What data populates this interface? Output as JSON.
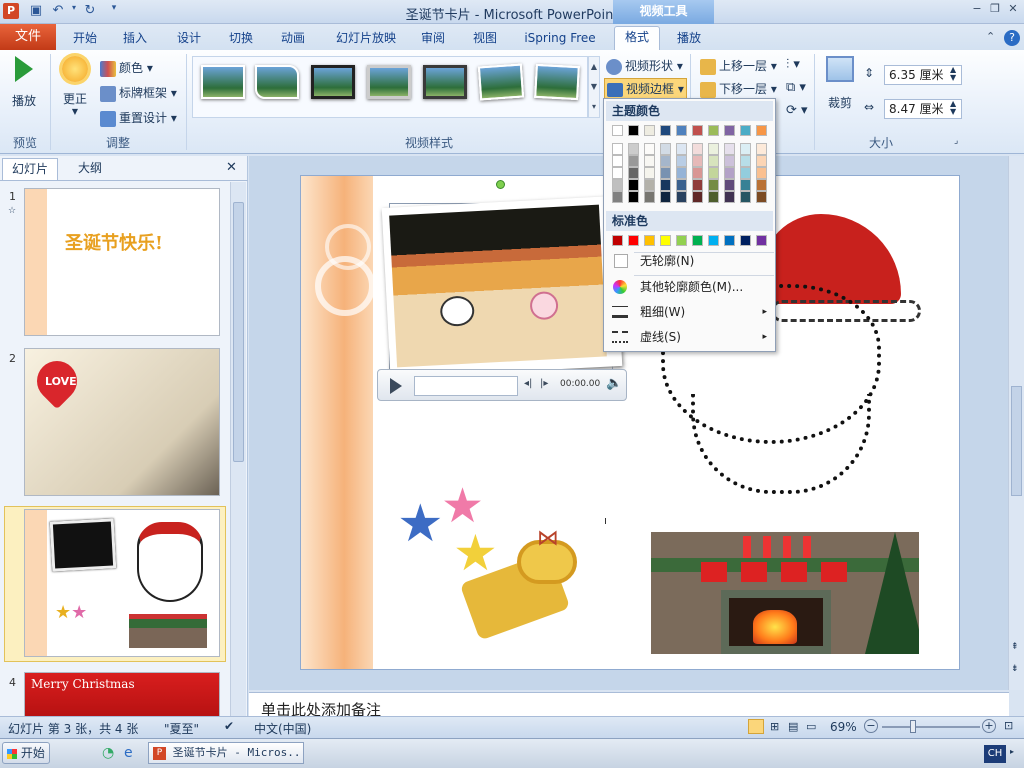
{
  "window": {
    "title": "圣诞节卡片 - Microsoft PowerPoint",
    "context_tab_group": "视频工具",
    "app_icon": "P",
    "controls": {
      "minimize": "−",
      "restore": "❐",
      "close": "✕"
    }
  },
  "tabs": {
    "file": "文件",
    "items": [
      "开始",
      "插入",
      "设计",
      "切换",
      "动画",
      "幻灯片放映",
      "审阅",
      "视图",
      "iSpring Free",
      "格式",
      "播放"
    ],
    "selected": "格式"
  },
  "ribbon": {
    "preview": {
      "play": "播放",
      "group": "预览"
    },
    "adjust": {
      "correct": "更正",
      "color": "颜色",
      "poster_frame": "标牌框架",
      "reset": "重置设计",
      "group": "调整"
    },
    "video_styles": {
      "group": "视频样式"
    },
    "video_shape": "视频形状",
    "video_border": "视频边框",
    "arrange": {
      "bring_forward": "上移一层",
      "send_backward": "下移一层"
    },
    "size": {
      "crop": "裁剪",
      "height": "6.35 厘米",
      "width": "8.47 厘米",
      "group": "大小"
    }
  },
  "panel": {
    "tab_slides": "幻灯片",
    "tab_outline": "大纲",
    "close": "✕",
    "slides": [
      {
        "num": "1",
        "title": "圣诞节快乐!"
      },
      {
        "num": "2",
        "title": "LOVE"
      },
      {
        "num": "3",
        "title": ""
      },
      {
        "num": "4",
        "title": "Merry Christmas"
      }
    ]
  },
  "border_menu": {
    "theme_colors_header": "主题颜色",
    "standard_colors_header": "标准色",
    "no_outline": "无轮廓(N)",
    "more_colors": "其他轮廓颜色(M)...",
    "weight": "粗细(W)",
    "dashes": "虚线(S)",
    "theme_top": [
      "#ffffff",
      "#000000",
      "#eeece1",
      "#1f497d",
      "#4f81bd",
      "#c0504d",
      "#9bbb59",
      "#8064a2",
      "#4bacc6",
      "#f79646"
    ],
    "standard": [
      "#c00000",
      "#ff0000",
      "#ffc000",
      "#ffff00",
      "#92d050",
      "#00b050",
      "#00b0f0",
      "#0070c0",
      "#002060",
      "#7030a0"
    ]
  },
  "video_player": {
    "time": "00:00.00"
  },
  "notes_placeholder": "单击此处添加备注",
  "status": {
    "slide_info": "幻灯片 第 3 张，共 4 张",
    "theme": "\"夏至\"",
    "language": "中文(中国)",
    "zoom": "69%"
  },
  "taskbar": {
    "start": "开始",
    "task": "圣诞节卡片 - Micros...",
    "ime": "CH"
  }
}
